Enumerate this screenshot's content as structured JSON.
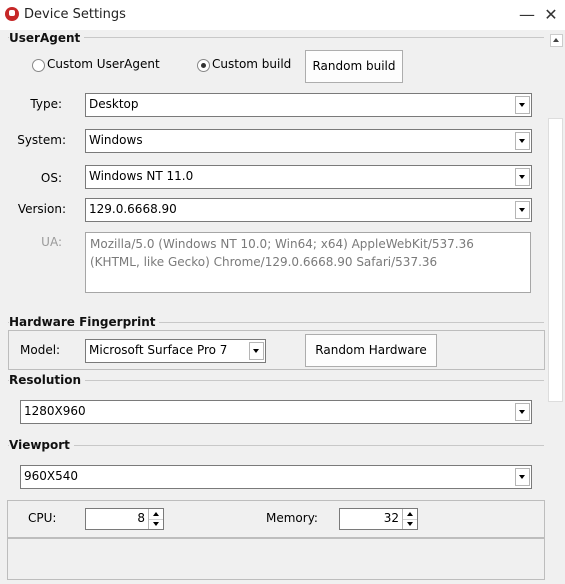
{
  "window": {
    "title": "Device Settings",
    "minimize_glyph": "—",
    "close_glyph": "✕"
  },
  "useragent": {
    "section_label": "UserAgent",
    "radio_custom_useragent": "Custom UserAgent",
    "radio_custom_build": "Custom build",
    "selected_mode": "Custom build",
    "random_build_label": "Random build",
    "type_label": "Type:",
    "type_value": "Desktop",
    "system_label": "System:",
    "system_value": "Windows",
    "os_label": "OS:",
    "os_value": "Windows NT 11.0",
    "version_label": "Version:",
    "version_value": "129.0.6668.90",
    "ua_label": "UA:",
    "ua_value": "Mozilla/5.0 (Windows NT 10.0; Win64; x64) AppleWebKit/537.36 (KHTML, like Gecko) Chrome/129.0.6668.90 Safari/537.36"
  },
  "hardware": {
    "section_label": "Hardware Fingerprint",
    "model_label": "Model:",
    "model_value": "Microsoft  Surface Pro 7",
    "random_hardware_label": "Random Hardware"
  },
  "resolution": {
    "section_label": "Resolution",
    "value": "1280X960"
  },
  "viewport": {
    "section_label": "Viewport",
    "value": "960X540"
  },
  "cpu": {
    "label": "CPU:",
    "value": "8"
  },
  "memory": {
    "label": "Memory:",
    "value": "32"
  },
  "icons": {
    "app": "app-logo-icon",
    "scroll_up": "chevron-up-icon",
    "dropdown": "chevron-down-icon"
  }
}
